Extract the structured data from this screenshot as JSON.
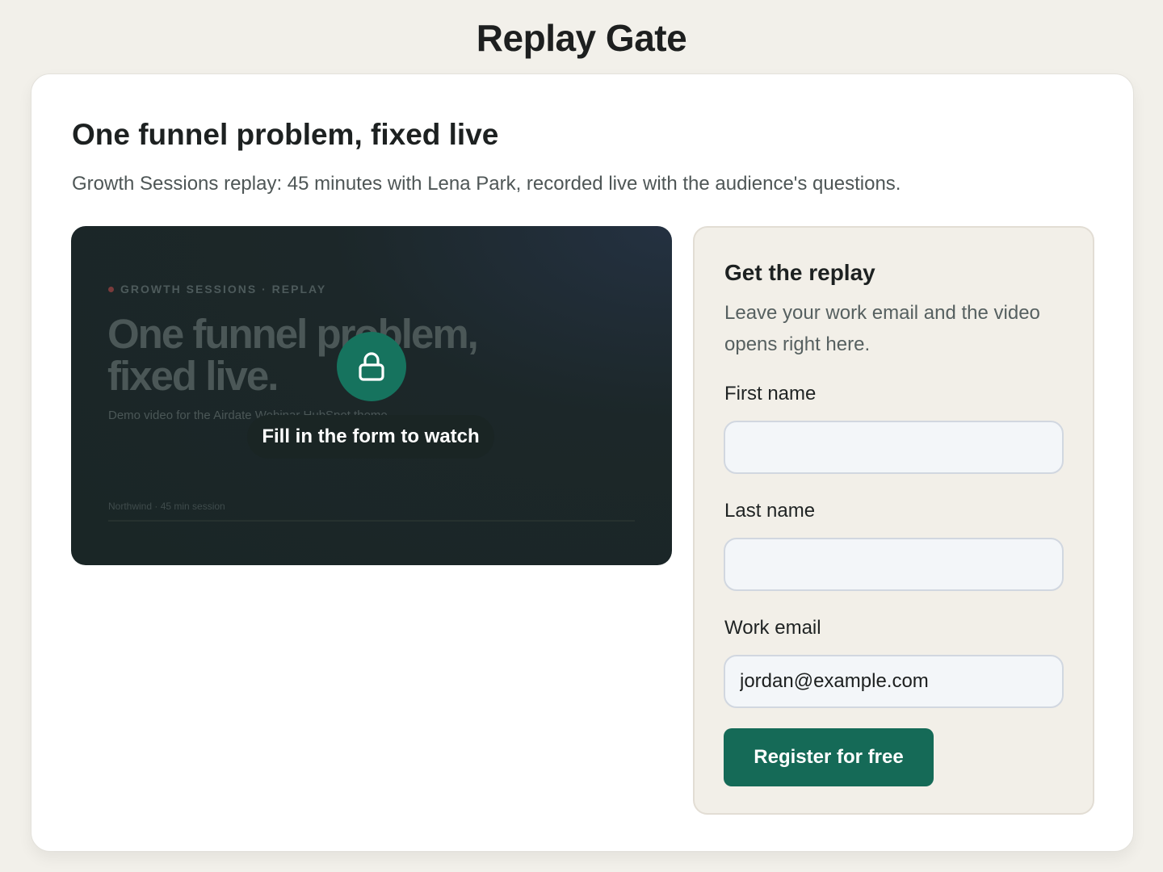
{
  "page": {
    "heading": "Replay Gate"
  },
  "hero": {
    "title": "One funnel problem, fixed live",
    "subtitle": "Growth Sessions replay: 45 minutes with Lena Park, recorded live with the audience's questions."
  },
  "video": {
    "eyebrow": "GROWTH SESSIONS · REPLAY",
    "headline": "One funnel problem, fixed live.",
    "description": "Demo video for the Airdate Webinar HubSpot theme",
    "footer": "Northwind · 45 min session",
    "overlay_label": "Fill in the form to watch",
    "lock_icon": "lock-icon",
    "accent_color": "#16735e"
  },
  "form": {
    "title": "Get the replay",
    "description": "Leave your work email and the video opens right here.",
    "fields": [
      {
        "label": "First name",
        "value": "",
        "placeholder": ""
      },
      {
        "label": "Last name",
        "value": "",
        "placeholder": ""
      },
      {
        "label": "Work email",
        "value": "jordan@example.com",
        "placeholder": ""
      }
    ],
    "submit_label": "Register for free",
    "button_color": "#156a57"
  }
}
